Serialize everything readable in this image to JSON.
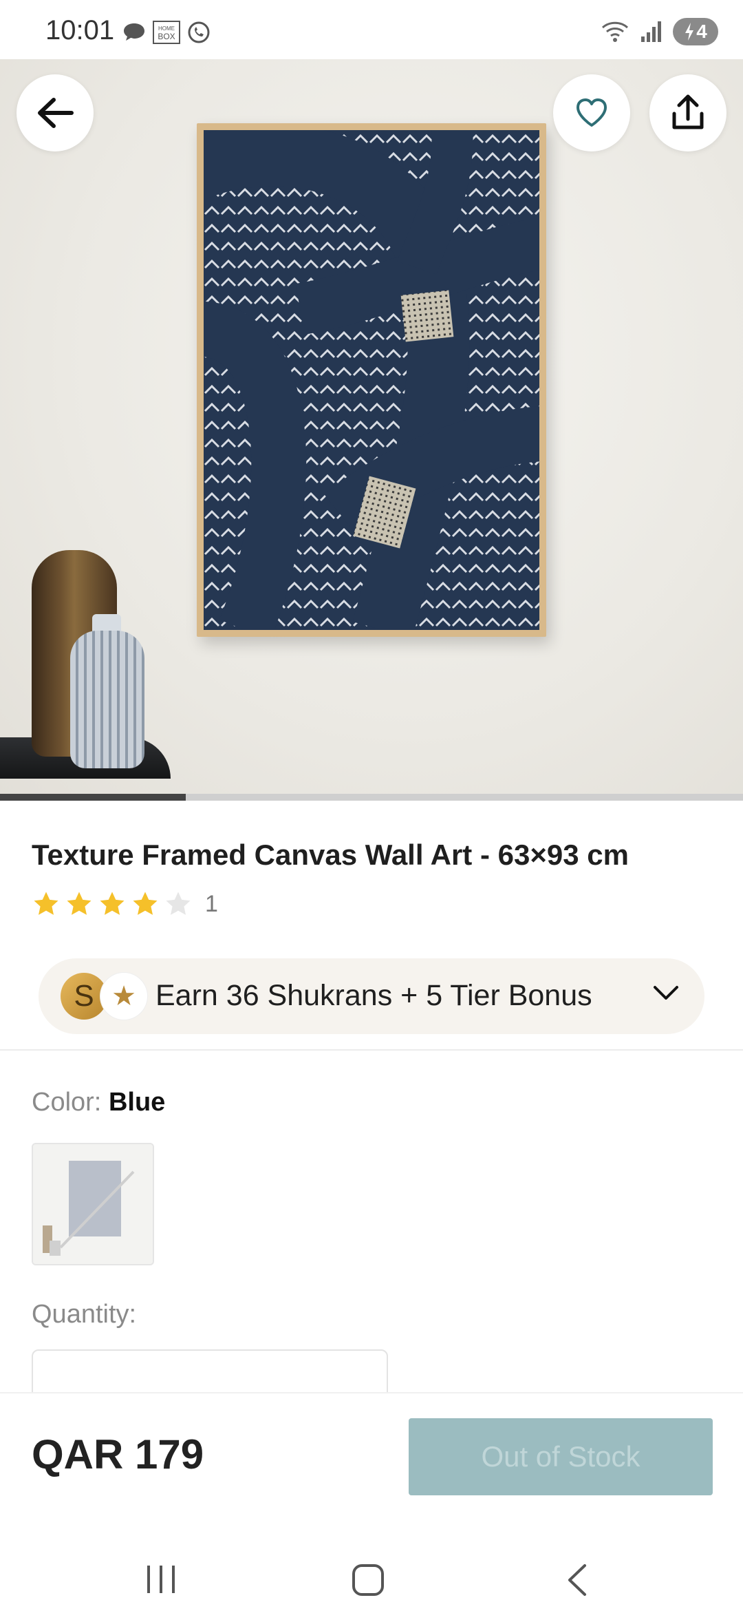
{
  "status_bar": {
    "time": "10:01",
    "battery": "4",
    "icons": [
      "chat-icon",
      "homebox-icon",
      "whatsapp-icon",
      "wifi-icon",
      "signal-icon",
      "battery-icon"
    ]
  },
  "hero": {
    "icons": [
      "back-arrow-icon",
      "heart-icon",
      "share-icon"
    ],
    "image_progress": 0.25
  },
  "product": {
    "title": "Texture Framed Canvas Wall Art - 63×93 cm",
    "rating": 4,
    "rating_max": 5,
    "rating_count": "1"
  },
  "shukran": {
    "text": "Earn 36 Shukrans + 5 Tier Bonus",
    "coin_letter": "S"
  },
  "color": {
    "label": "Color:",
    "value": "Blue"
  },
  "quantity": {
    "label": "Quantity:"
  },
  "bottom": {
    "price": "QAR 179",
    "button_label": "Out of Stock"
  },
  "colors": {
    "accent_teal": "#9bbcc0",
    "star": "#f5c02a",
    "canvas_navy": "#253752"
  }
}
